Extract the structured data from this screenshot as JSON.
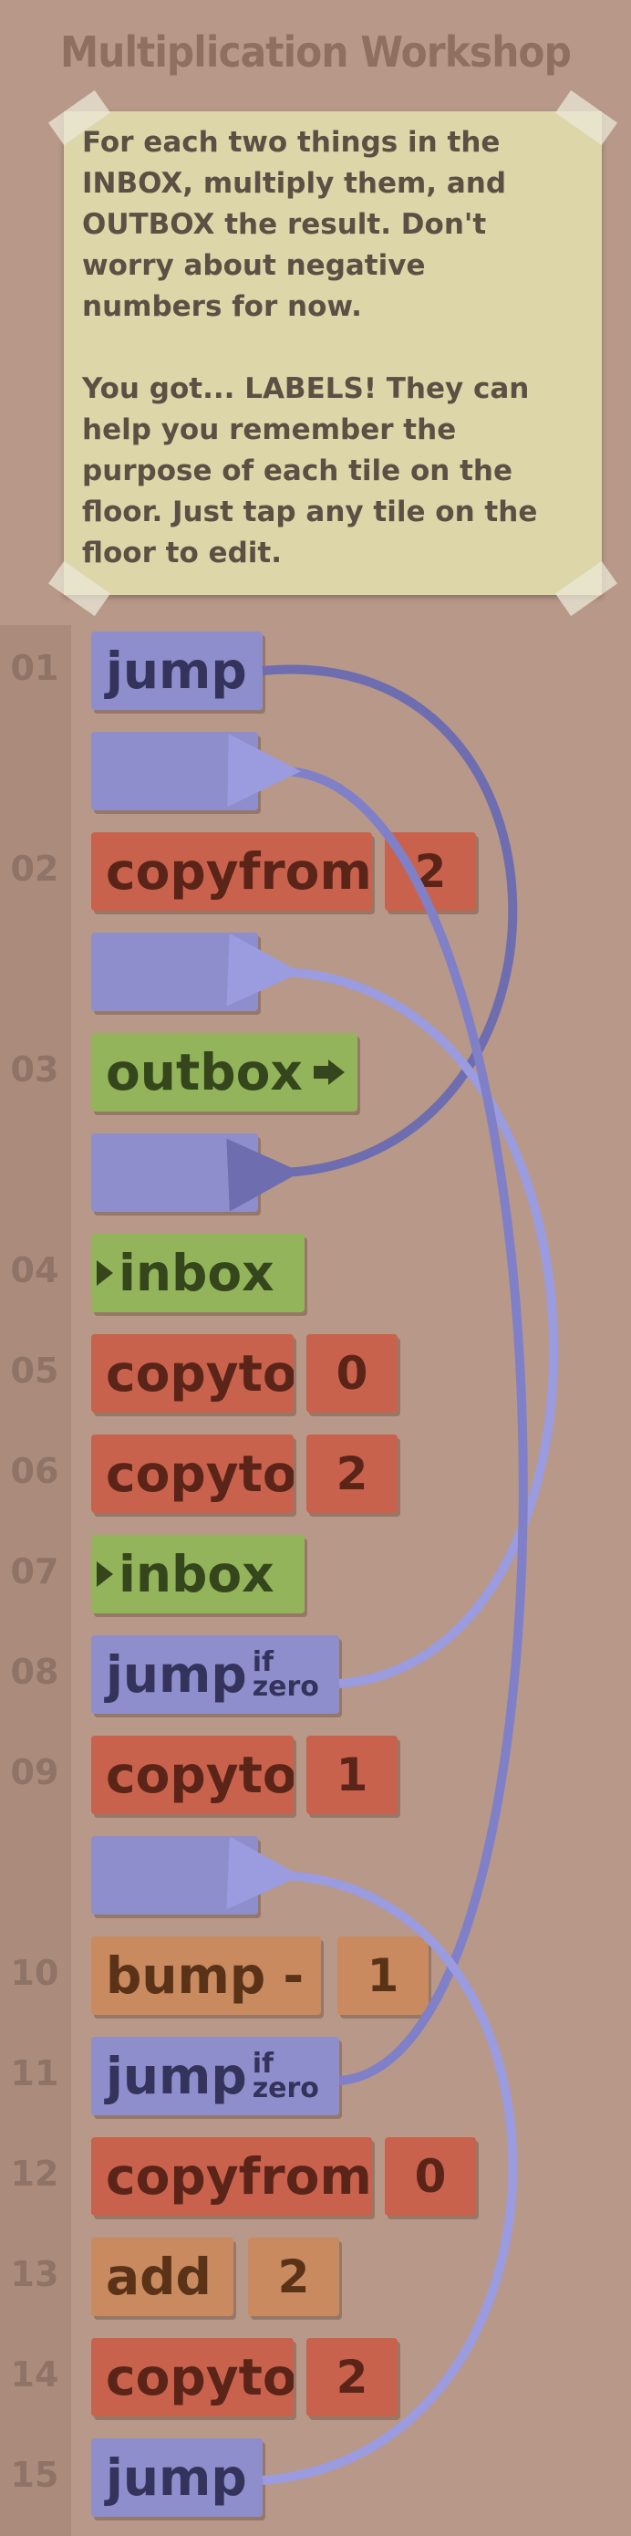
{
  "title": "Multiplication Workshop",
  "instructions": {
    "paragraph1": "For each two things in the INBOX, multiply them, and OUTBOX the result. Don't worry about negative numbers for now.",
    "paragraph2": "You got... LABELS! They can help you remember the purpose of each tile on the floor. Just tap any tile on the floor to edit."
  },
  "program": {
    "line_numbers": [
      "01",
      "02",
      "03",
      "04",
      "05",
      "06",
      "07",
      "08",
      "09",
      "10",
      "11",
      "12",
      "13",
      "14",
      "15"
    ],
    "instructions": [
      {
        "line": "01",
        "command": "jump",
        "arg": "",
        "jump_if": "",
        "jump_cond": ""
      },
      {
        "line": "02",
        "command": "copyfrom",
        "arg": "2",
        "jump_if": "",
        "jump_cond": ""
      },
      {
        "line": "03",
        "command": "outbox",
        "arg": "",
        "jump_if": "",
        "jump_cond": ""
      },
      {
        "line": "04",
        "command": "inbox",
        "arg": "",
        "jump_if": "",
        "jump_cond": ""
      },
      {
        "line": "05",
        "command": "copyto",
        "arg": "0",
        "jump_if": "",
        "jump_cond": ""
      },
      {
        "line": "06",
        "command": "copyto",
        "arg": "2",
        "jump_if": "",
        "jump_cond": ""
      },
      {
        "line": "07",
        "command": "inbox",
        "arg": "",
        "jump_if": "",
        "jump_cond": ""
      },
      {
        "line": "08",
        "command": "jump",
        "arg": "",
        "jump_if": "if",
        "jump_cond": "zero"
      },
      {
        "line": "09",
        "command": "copyto",
        "arg": "1",
        "jump_if": "",
        "jump_cond": ""
      },
      {
        "line": "10",
        "command": "bump -",
        "arg": "1",
        "jump_if": "",
        "jump_cond": ""
      },
      {
        "line": "11",
        "command": "jump",
        "arg": "",
        "jump_if": "if",
        "jump_cond": "zero"
      },
      {
        "line": "12",
        "command": "copyfrom",
        "arg": "0",
        "jump_if": "",
        "jump_cond": ""
      },
      {
        "line": "13",
        "command": "add",
        "arg": "2",
        "jump_if": "",
        "jump_cond": ""
      },
      {
        "line": "14",
        "command": "copyto",
        "arg": "2",
        "jump_if": "",
        "jump_cond": ""
      },
      {
        "line": "15",
        "command": "jump",
        "arg": "",
        "jump_if": "",
        "jump_cond": ""
      }
    ]
  },
  "colors": {
    "background": "#b89888",
    "jump": "#8e8ecc",
    "copy": "#c9624c",
    "io": "#93b45a",
    "math": "#c88a5e",
    "arrow_light": "#9b9be0",
    "arrow_dark": "#6d6daf"
  },
  "icons": [
    "inbox-arrow-icon",
    "outbox-arrow-icon",
    "jump-arrow-icon"
  ]
}
